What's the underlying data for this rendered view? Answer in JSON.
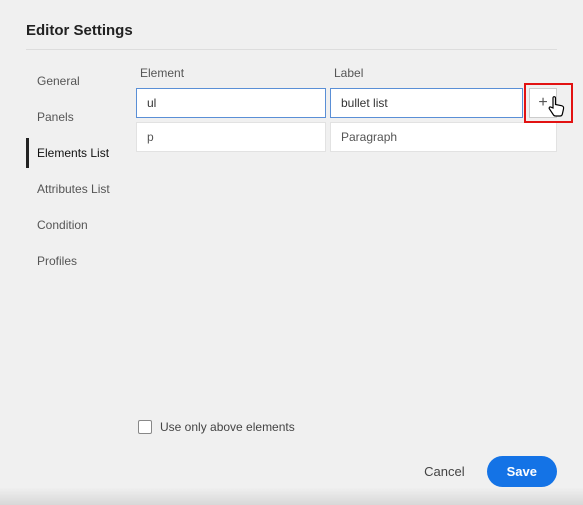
{
  "title": "Editor Settings",
  "sidebar": {
    "items": [
      {
        "label": "General",
        "active": false
      },
      {
        "label": "Panels",
        "active": false
      },
      {
        "label": "Elements List",
        "active": true
      },
      {
        "label": "Attributes List",
        "active": false
      },
      {
        "label": "Condition",
        "active": false
      },
      {
        "label": "Profiles",
        "active": false
      }
    ]
  },
  "columns": {
    "element": "Element",
    "label": "Label"
  },
  "rows": [
    {
      "element": "ul",
      "label": "bullet list",
      "editing": true
    },
    {
      "element": "p",
      "label": "Paragraph",
      "editing": false
    }
  ],
  "addButton": {
    "glyph": "+"
  },
  "checkbox": {
    "label": "Use only above elements",
    "checked": false
  },
  "footer": {
    "cancel": "Cancel",
    "save": "Save"
  }
}
